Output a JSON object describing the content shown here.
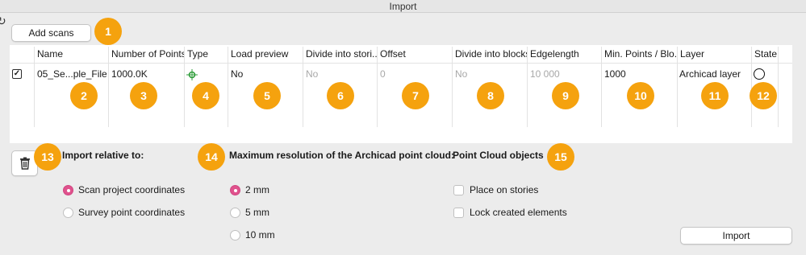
{
  "window": {
    "title": "Import"
  },
  "toolbar": {
    "add_scans_label": "Add scans"
  },
  "table": {
    "headers": [
      "Name",
      "Number of Points",
      "Type",
      "Load preview",
      "Divide into stori...",
      "Offset",
      "Divide into blocks",
      "Edgelength",
      "Min. Points / Blo...",
      "Layer",
      "State"
    ],
    "row": {
      "checked": true,
      "name": "05_Se...ple_File",
      "points": "1000.0K",
      "load_preview": "No",
      "divide_stories": "No",
      "offset": "0",
      "divide_blocks": "No",
      "edgelength": "10 000",
      "min_points": "1000",
      "layer": "Archicad layer"
    }
  },
  "badges": [
    "1",
    "2",
    "3",
    "4",
    "5",
    "6",
    "7",
    "8",
    "9",
    "10",
    "11",
    "12",
    "13",
    "14",
    "15"
  ],
  "import_relative": {
    "title": "Import relative to:",
    "options": [
      "Scan project coordinates",
      "Survey point coordinates"
    ],
    "selected": 0
  },
  "max_resolution": {
    "title": "Maximum resolution of the Archicad point cloud:",
    "options": [
      "2 mm",
      "5 mm",
      "10 mm"
    ],
    "selected": 0
  },
  "point_cloud_objects": {
    "title": "Point Cloud objects",
    "options": [
      "Place on stories",
      "Lock created elements"
    ]
  },
  "footer": {
    "import_label": "Import"
  },
  "colors": {
    "badge": "#f5a20e",
    "radio_selected": "#e0528d"
  }
}
